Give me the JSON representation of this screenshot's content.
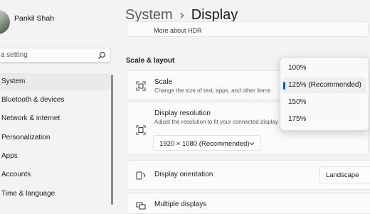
{
  "user": {
    "name": "Pankil Shah"
  },
  "search": {
    "placeholder": "a setting",
    "icon": "search-icon"
  },
  "sidebar": {
    "items": [
      {
        "label": "System",
        "active": true
      },
      {
        "label": "Bluetooth & devices"
      },
      {
        "label": "Network & internet"
      },
      {
        "label": "Personalization"
      },
      {
        "label": "Apps"
      },
      {
        "label": "Accounts"
      },
      {
        "label": "Time & language"
      }
    ]
  },
  "header": {
    "crumb": "System",
    "separator": "›",
    "title": "Display"
  },
  "main": {
    "hdr_link": "More about HDR",
    "section": "Scale & layout",
    "scale": {
      "title": "Scale",
      "subtitle": "Change the size of text, apps, and other items",
      "icon": "scale-icon"
    },
    "resolution": {
      "title": "Display resolution",
      "subtitle": "Adjust the resolution to fit your connected display",
      "value": "1920 × 1080 (Recommended)",
      "icon": "resolution-icon"
    },
    "orientation": {
      "title": "Display orientation",
      "value": "Landscape",
      "icon": "orientation-icon"
    },
    "multiple": {
      "title": "Multiple displays"
    }
  },
  "scale_menu": {
    "options": [
      "100%",
      "125% (Recommended)",
      "150%",
      "175%"
    ],
    "selected": "125% (Recommended)"
  },
  "colors": {
    "accent": "#005fb8",
    "background": "#f3f3f3",
    "card": "#fbfbfb"
  }
}
